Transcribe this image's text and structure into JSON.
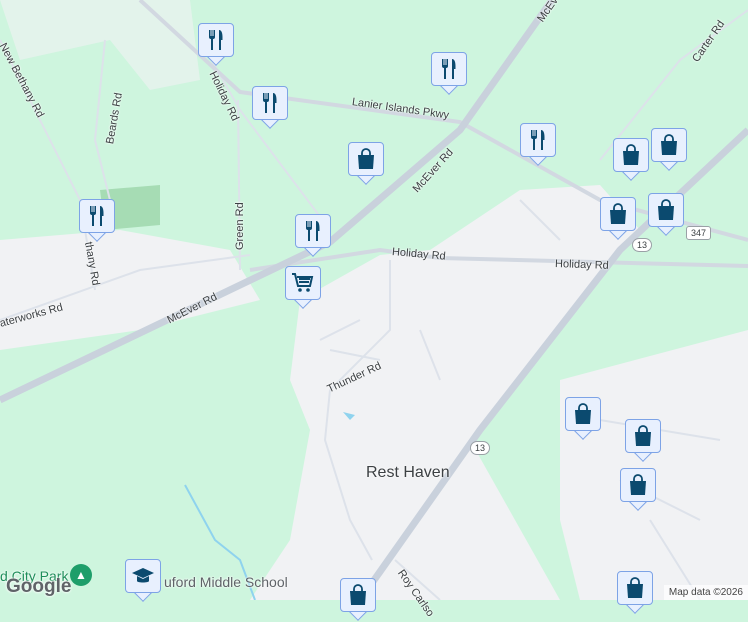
{
  "colors": {
    "park": "#cef5de",
    "urban": "#f1f2f4",
    "road": "#dde2ea",
    "highway": "#c9d1dc",
    "pin_fill": "#e8f0fe",
    "pin_border": "#7da3e6",
    "icon": "#0b4a6f",
    "water": "#8fd3ee"
  },
  "roads": {
    "mcever_1": "McEver Rd",
    "mcever_2": "McEver Rd",
    "mcever_3": "McEv",
    "lanier": "Lanier Islands Pkwy",
    "holiday_1": "Holiday Rd",
    "holiday_2": "Holiday Rd",
    "holiday_3": "Holiday Rd",
    "green": "Green Rd",
    "beards": "Beards Rd",
    "new_bethany": "New Bethany Rd",
    "bethany_2": "thany Rd",
    "waterworks": "aterworks Rd",
    "thunder": "Thunder Rd",
    "carter": "Carter Rd",
    "roy_carlson": "Roy Carlso"
  },
  "shields": {
    "hwy13_a": "13",
    "hwy13_b": "13",
    "hwy347": "347"
  },
  "places": {
    "rest_haven": "Rest Haven",
    "school": "uford Middle School",
    "park": "d City Park"
  },
  "pins": {
    "restaurant": "restaurant-icon",
    "shopping": "shopping-bag-icon",
    "grocery": "shopping-cart-icon",
    "school": "school-icon",
    "park": "tree-icon"
  },
  "attribution": {
    "logo": "Google",
    "map_data": "Map data ©2026"
  }
}
